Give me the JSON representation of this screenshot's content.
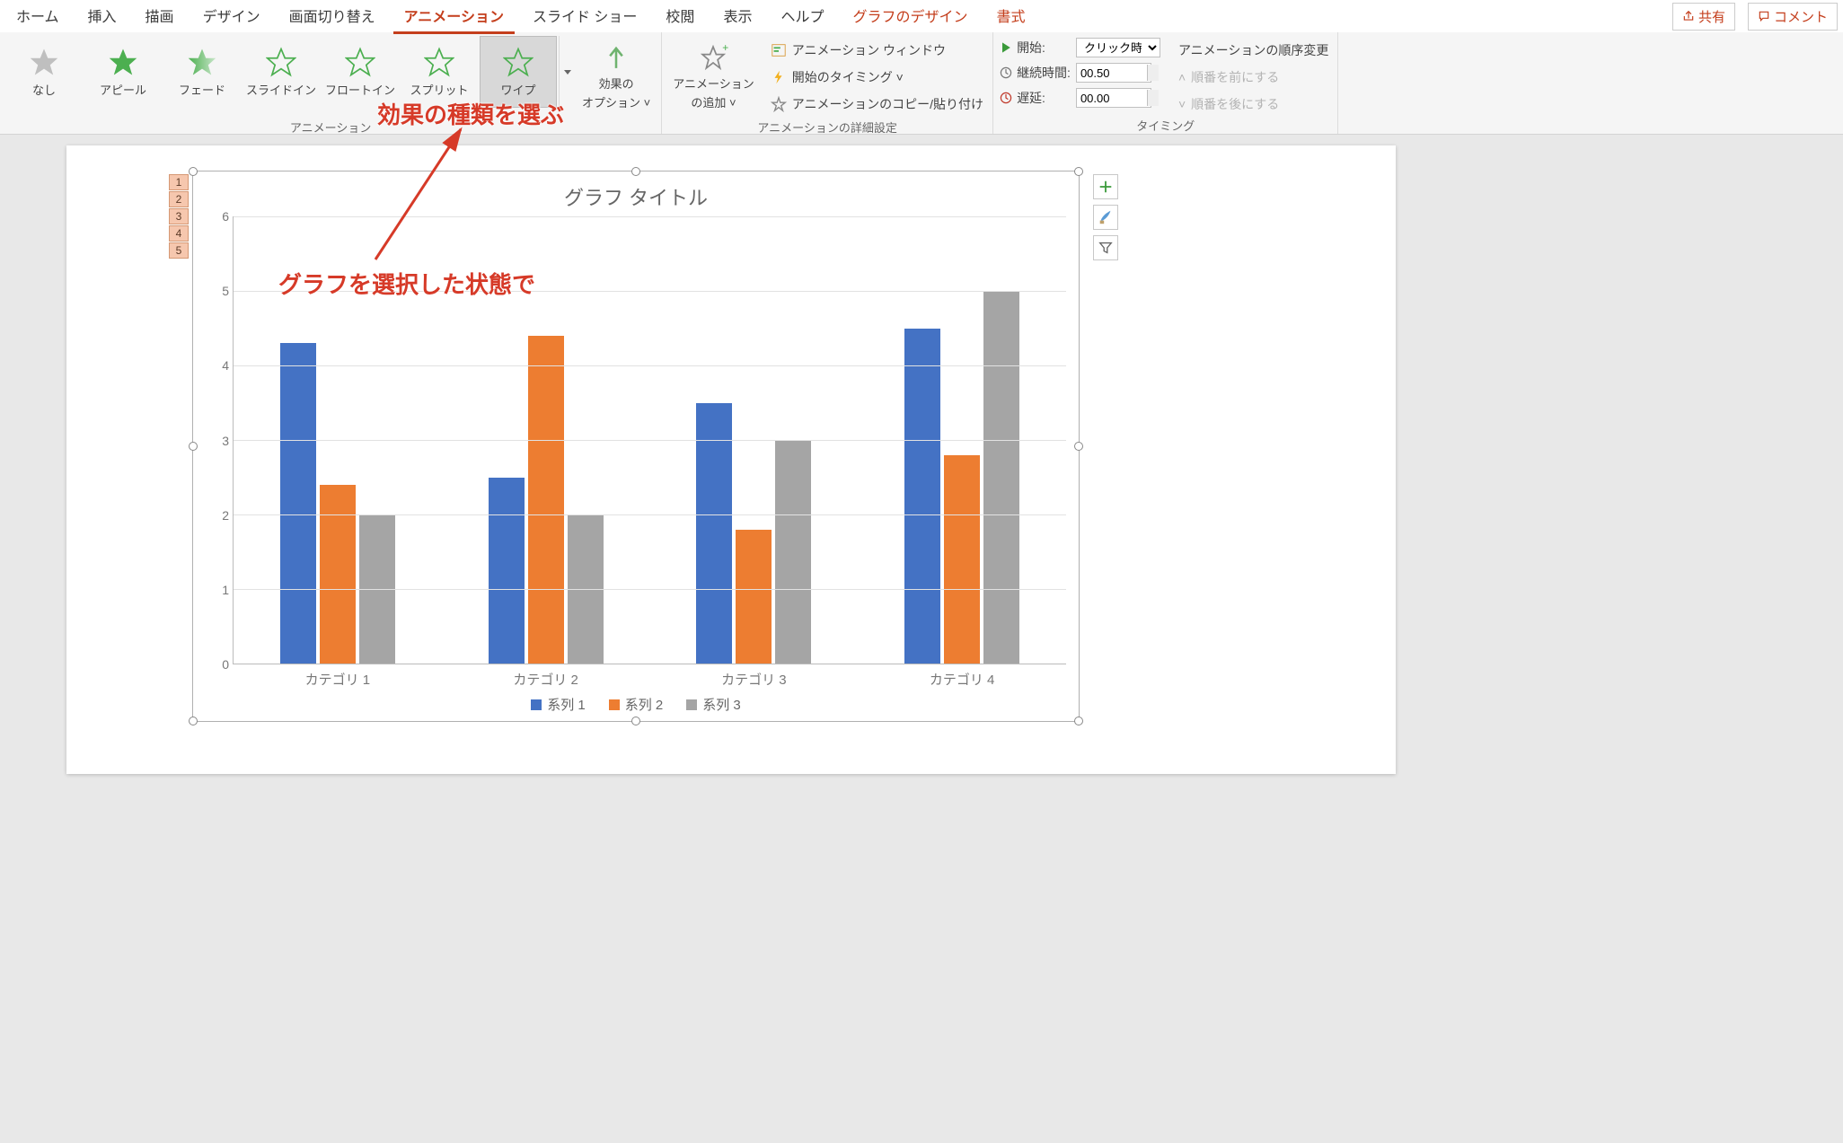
{
  "tabs": {
    "items": [
      "ホーム",
      "挿入",
      "描画",
      "デザイン",
      "画面切り替え",
      "アニメーション",
      "スライド ショー",
      "校閲",
      "表示",
      "ヘルプ"
    ],
    "active_index": 5,
    "contextual": [
      "グラフのデザイン",
      "書式"
    ],
    "share": "共有",
    "comment": "コメント"
  },
  "ribbon": {
    "anim_group_label": "アニメーション",
    "effects": [
      {
        "label": "なし"
      },
      {
        "label": "アピール"
      },
      {
        "label": "フェード"
      },
      {
        "label": "スライドイン"
      },
      {
        "label": "フロートイン"
      },
      {
        "label": "スプリット"
      },
      {
        "label": "ワイプ"
      }
    ],
    "selected_effect_index": 6,
    "effect_options": {
      "line1": "効果の",
      "line2": "オプション"
    },
    "add_anim": {
      "line1": "アニメーション",
      "line2": "の追加"
    },
    "adv_group_label": "アニメーションの詳細設定",
    "adv_cmds": {
      "pane": "アニメーション ウィンドウ",
      "trigger": "開始のタイミング",
      "painter": "アニメーションのコピー/貼り付け"
    },
    "timing_group_label": "タイミング",
    "timing": {
      "start_label": "開始:",
      "start_value": "クリック時",
      "duration_label": "継続時間:",
      "duration_value": "00.50",
      "delay_label": "遅延:",
      "delay_value": "00.00",
      "reorder_label": "アニメーションの順序変更",
      "move_before": "順番を前にする",
      "move_after": "順番を後にする"
    }
  },
  "chart_data": {
    "type": "bar",
    "title": "グラフ タイトル",
    "categories": [
      "カテゴリ 1",
      "カテゴリ 2",
      "カテゴリ 3",
      "カテゴリ 4"
    ],
    "series": [
      {
        "name": "系列 1",
        "color": "#4472c4",
        "values": [
          4.3,
          2.5,
          3.5,
          4.5
        ]
      },
      {
        "name": "系列 2",
        "color": "#ed7d31",
        "values": [
          2.4,
          4.4,
          1.8,
          2.8
        ]
      },
      {
        "name": "系列 3",
        "color": "#a5a5a5",
        "values": [
          2.0,
          2.0,
          3.0,
          5.0
        ]
      }
    ],
    "ylim": [
      0,
      6
    ],
    "yticks": [
      0,
      1,
      2,
      3,
      4,
      5,
      6
    ]
  },
  "anim_tags": [
    "1",
    "2",
    "3",
    "4",
    "5"
  ],
  "callouts": {
    "top": "効果の種類を選ぶ",
    "mid": "グラフを選択した状態で"
  }
}
